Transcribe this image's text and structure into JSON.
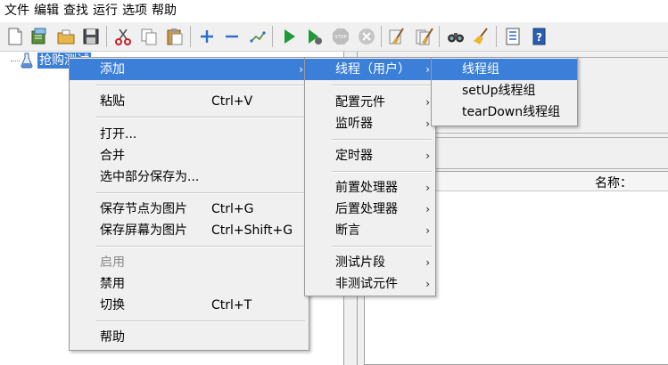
{
  "menubar": {
    "items": [
      "文件",
      "编辑",
      "查找",
      "运行",
      "选项",
      "帮助"
    ]
  },
  "toolbar": {
    "buttons": [
      "new-icon",
      "templates-icon",
      "open-icon",
      "save-icon",
      "cut-icon",
      "copy-icon",
      "paste-icon",
      "expand-icon",
      "collapse-icon",
      "toggle-icon",
      "start-icon",
      "start-no-pause-icon",
      "stop-icon",
      "shutdown-icon",
      "clear-icon",
      "clear-all-icon",
      "search-icon",
      "reset-search-icon",
      "function-helper-icon",
      "help-icon"
    ]
  },
  "tree": {
    "node_label": "抢购测试"
  },
  "right_panel": {
    "name_label": "名称："
  },
  "context_menu": {
    "add": "添加",
    "paste": "粘贴",
    "paste_shortcut": "Ctrl+V",
    "open": "打开...",
    "merge": "合并",
    "save_selection_as": "选中部分保存为...",
    "save_node_as_image": "保存节点为图片",
    "save_node_as_image_shortcut": "Ctrl+G",
    "save_screen_as_image": "保存屏幕为图片",
    "save_screen_as_image_shortcut": "Ctrl+Shift+G",
    "enable": "启用",
    "disable": "禁用",
    "toggle": "切换",
    "toggle_shortcut": "Ctrl+T",
    "help": "帮助"
  },
  "add_submenu": {
    "threads": "线程（用户）",
    "config_element": "配置元件",
    "listener": "监听器",
    "timer": "定时器",
    "pre_processor": "前置处理器",
    "post_processor": "后置处理器",
    "assertion": "断言",
    "test_fragment": "测试片段",
    "non_test_elements": "非测试元件"
  },
  "threads_submenu": {
    "thread_group": "线程组",
    "setup_thread_group": "setUp线程组",
    "teardown_thread_group": "tearDown线程组"
  },
  "colors": {
    "highlight": "#3b7fd9",
    "menu_bg": "#f0f0f0",
    "disabled_text": "#8a8a8a"
  }
}
